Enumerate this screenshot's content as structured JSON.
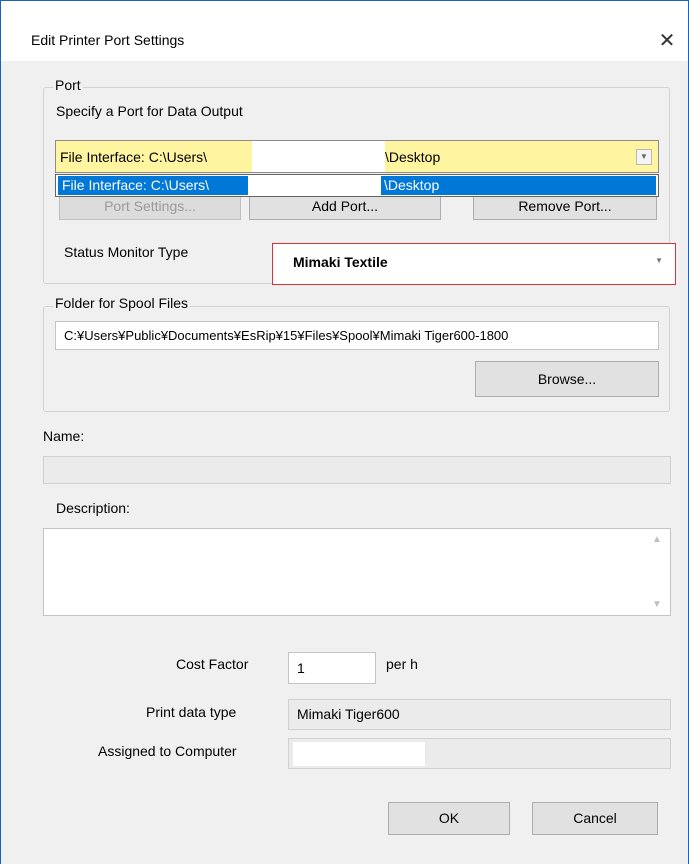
{
  "window": {
    "title": "Edit Printer Port Settings",
    "close_glyph": "✕"
  },
  "port_group": {
    "legend": "Port",
    "instruction": "Specify a Port for Data Output",
    "selected_port_prefix": "File Interface: C:\\Users\\",
    "selected_port_suffix": "\\Desktop",
    "dropdown_item_prefix": "File Interface: C:\\Users\\",
    "dropdown_item_suffix": "\\Desktop",
    "port_settings_button": "Port Settings...",
    "add_port_button": "Add Port...",
    "remove_port_button": "Remove Port...",
    "status_monitor_label": "Status Monitor Type",
    "status_monitor_value": "Mimaki Textile"
  },
  "spool_group": {
    "legend": "Folder for Spool Files",
    "path": "C:¥Users¥Public¥Documents¥EsRip¥15¥Files¥Spool¥Mimaki Tiger600-1800",
    "browse_button": "Browse..."
  },
  "name": {
    "label": "Name:",
    "value": ""
  },
  "description": {
    "label": "Description:",
    "value": ""
  },
  "cost": {
    "label": "Cost Factor",
    "value": "1",
    "unit": "per h"
  },
  "print_data_type": {
    "label": "Print data type",
    "value": "Mimaki Tiger600"
  },
  "assigned_computer": {
    "label": "Assigned to Computer",
    "value": ""
  },
  "buttons": {
    "ok": "OK",
    "cancel": "Cancel"
  },
  "colors": {
    "highlight": "#0078d7",
    "combo_highlight": "#fff5a0",
    "focus_outline": "#e0303a"
  }
}
